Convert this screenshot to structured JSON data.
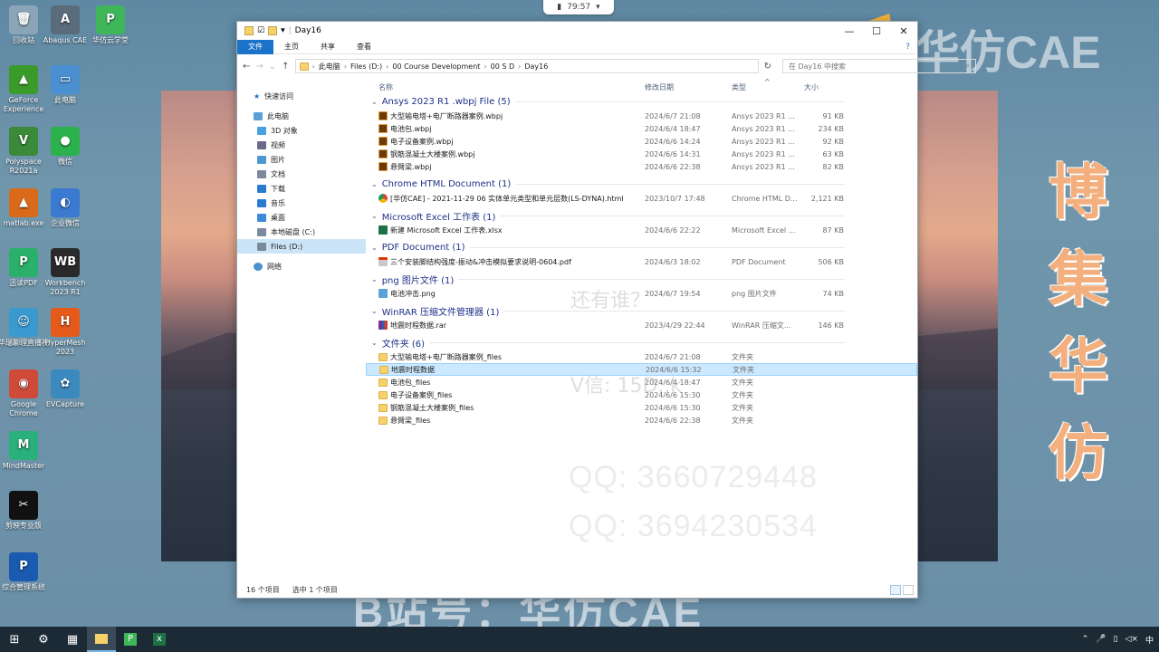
{
  "clock": {
    "time": "79:57"
  },
  "desktop_icons": [
    {
      "label": "回收站",
      "color": "#8aa4b8",
      "glyph": "🗑"
    },
    {
      "label": "Abaqus CAE",
      "color": "#5a6b7a",
      "glyph": "A"
    },
    {
      "label": "华仿云学堂",
      "color": "#3fb65a",
      "glyph": "P"
    },
    {
      "label": "GeForce Experience",
      "color": "#3a9a2a",
      "glyph": "▲"
    },
    {
      "label": "此电脑",
      "color": "#4a8fd0",
      "glyph": "▭"
    },
    {
      "label": "Polyspace R2021a",
      "color": "#3a8a3a",
      "glyph": "V"
    },
    {
      "label": "微信",
      "color": "#2bb24c",
      "glyph": "●"
    },
    {
      "label": "matlab.exe",
      "color": "#d86a1a",
      "glyph": "▲"
    },
    {
      "label": "企业微信",
      "color": "#3a7ad0",
      "glyph": "◐"
    },
    {
      "label": "迅读PDF",
      "color": "#2ab06a",
      "glyph": "P"
    },
    {
      "label": "Workbench 2023 R1",
      "color": "#2a2a2a",
      "glyph": "WB"
    },
    {
      "label": "华瑞聊理直播视",
      "color": "#3a9ad0",
      "glyph": "☺"
    },
    {
      "label": "HyperMesh 2023",
      "color": "#e55a1a",
      "glyph": "H"
    },
    {
      "label": "Google Chrome",
      "color": "#d04a3a",
      "glyph": "◉"
    },
    {
      "label": "EVCapture",
      "color": "#3a8ac0",
      "glyph": "✿"
    },
    {
      "label": "MindMaster",
      "color": "#2ab07a",
      "glyph": "M"
    },
    {
      "label": "剪映专业版",
      "color": "#111111",
      "glyph": "✂"
    },
    {
      "label": "综合管理系统",
      "color": "#1a5ab0",
      "glyph": "P"
    }
  ],
  "watermark": {
    "qq1": "QQ: 3660729448",
    "qq2": "QQ: 3694230534",
    "q_text": "还有谁？",
    "v_text": "V信: 15D..k",
    "brand_top": "华仿CAE",
    "brand_vertical": [
      "博",
      "集",
      "华",
      "仿"
    ],
    "brand_bottom": "B站号：华仿CAE"
  },
  "window": {
    "title": "Day16",
    "ribbon_tabs": [
      "文件",
      "主页",
      "共享",
      "查看"
    ],
    "breadcrumb": [
      "此电脑",
      "Files (D:)",
      "00 Course Development",
      "00 S D",
      "Day16"
    ],
    "search_placeholder": "在 Day16 中搜索",
    "nav": {
      "quick_access": "快速访问",
      "this_pc": "此电脑",
      "items": [
        "3D 对象",
        "视频",
        "图片",
        "文档",
        "下载",
        "音乐",
        "桌面",
        "本地磁盘 (C:)",
        "Files (D:)"
      ],
      "network": "网络"
    },
    "columns": {
      "name": "名称",
      "date": "修改日期",
      "type": "类型",
      "size": "大小"
    },
    "groups": [
      {
        "title": "Ansys 2023 R1 .wbpj File (5)",
        "icon": "wb",
        "rows": [
          {
            "name": "大型输电塔+电厂断路器案例.wbpj",
            "date": "2024/6/7 21:08",
            "type": "Ansys 2023 R1 ...",
            "size": "91 KB"
          },
          {
            "name": "电池包.wbpj",
            "date": "2024/6/4 18:47",
            "type": "Ansys 2023 R1 ...",
            "size": "234 KB"
          },
          {
            "name": "电子设备案例.wbpj",
            "date": "2024/6/6 14:24",
            "type": "Ansys 2023 R1 ...",
            "size": "92 KB"
          },
          {
            "name": "钢筋混凝土大楼案例.wbpj",
            "date": "2024/6/6 14:31",
            "type": "Ansys 2023 R1 ...",
            "size": "63 KB"
          },
          {
            "name": "悬臂梁.wbpj",
            "date": "2024/6/6 22:38",
            "type": "Ansys 2023 R1 ...",
            "size": "82 KB"
          }
        ]
      },
      {
        "title": "Chrome HTML Document (1)",
        "icon": "chrome",
        "rows": [
          {
            "name": "[华仿CAE] - 2021-11-29 06 实体单元类型和单元层数(LS-DYNA).html",
            "date": "2023/10/7 17:48",
            "type": "Chrome HTML D...",
            "size": "2,121 KB"
          }
        ]
      },
      {
        "title": "Microsoft Excel 工作表 (1)",
        "icon": "xls",
        "rows": [
          {
            "name": "新建 Microsoft Excel 工作表.xlsx",
            "date": "2024/6/6 22:22",
            "type": "Microsoft Excel ...",
            "size": "87 KB"
          }
        ]
      },
      {
        "title": "PDF Document (1)",
        "icon": "pdf",
        "rows": [
          {
            "name": "三个安装脚结构强度-振动&冲击模拟要求说明-0604.pdf",
            "date": "2024/6/3 18:02",
            "type": "PDF Document",
            "size": "506 KB"
          }
        ]
      },
      {
        "title": "png 图片文件 (1)",
        "icon": "png",
        "rows": [
          {
            "name": "电池冲击.png",
            "date": "2024/6/7 19:54",
            "type": "png 图片文件",
            "size": "74 KB"
          }
        ]
      },
      {
        "title": "WinRAR 压缩文件管理器 (1)",
        "icon": "rar",
        "rows": [
          {
            "name": "地震时程数据.rar",
            "date": "2023/4/29 22:44",
            "type": "WinRAR 压缩文...",
            "size": "146 KB"
          }
        ]
      },
      {
        "title": "文件夹 (6)",
        "icon": "folder",
        "rows": [
          {
            "name": "大型输电塔+电厂断路器案例_files",
            "date": "2024/6/7 21:08",
            "type": "文件夹",
            "size": ""
          },
          {
            "name": "地震时程数据",
            "date": "2024/6/6 15:32",
            "type": "文件夹",
            "size": "",
            "selected": true
          },
          {
            "name": "电池包_files",
            "date": "2024/6/4 18:47",
            "type": "文件夹",
            "size": ""
          },
          {
            "name": "电子设备案例_files",
            "date": "2024/6/6 15:30",
            "type": "文件夹",
            "size": ""
          },
          {
            "name": "钢筋混凝土大楼案例_files",
            "date": "2024/6/6 15:30",
            "type": "文件夹",
            "size": ""
          },
          {
            "name": "悬臂梁_files",
            "date": "2024/6/6 22:38",
            "type": "文件夹",
            "size": ""
          }
        ]
      }
    ],
    "status": {
      "count": "16 个项目",
      "selected": "选中 1 个项目"
    }
  },
  "tray": {
    "lang": "中"
  }
}
